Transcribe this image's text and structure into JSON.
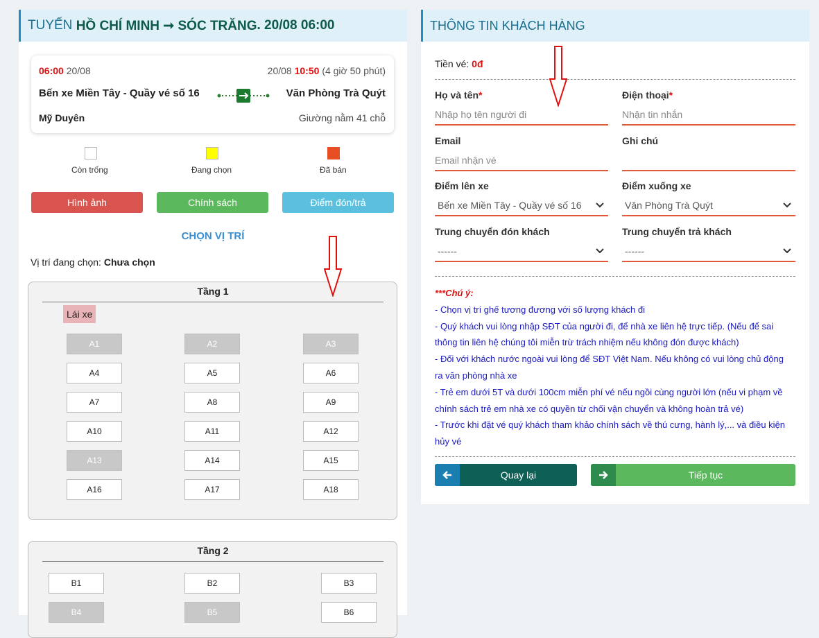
{
  "left": {
    "title_prefix": "TUYẾN",
    "title_route": "HỒ CHÍ MINH ➞ SÓC TRĂNG",
    "title_time": ". 20/08 06:00",
    "trip": {
      "depart_time": "06:00",
      "depart_date": "20/08",
      "arrive_date": "20/08",
      "arrive_time": "10:50",
      "duration": "(4 giờ 50 phút)",
      "from": "Bến xe Miền Tây - Quầy vé số 16",
      "to": "Văn Phòng Trà Quýt",
      "operator": "Mỹ Duyên",
      "vehicle": "Giường nằm 41 chỗ"
    },
    "legend": {
      "empty": "Còn trống",
      "selecting": "Đang chọn",
      "sold": "Đã bán"
    },
    "colors": {
      "empty": "#ffffff",
      "selecting": "#ffff00",
      "sold": "#e84e23"
    },
    "buttons": {
      "images": "Hình ảnh",
      "policy": "Chính sách",
      "pickup": "Điểm đón/trả"
    },
    "choose_seat": "CHỌN VỊ TRÍ",
    "selected_label": "Vị trí đang chọn:",
    "selected_value": "Chưa chọn",
    "floor1": {
      "title": "Tầng 1",
      "driver": "Lái xe",
      "seats": [
        {
          "label": "A1",
          "sold": true
        },
        {
          "label": "A2",
          "sold": true
        },
        {
          "label": "A3",
          "sold": true
        },
        {
          "label": "A4",
          "sold": false
        },
        {
          "label": "A5",
          "sold": false
        },
        {
          "label": "A6",
          "sold": false
        },
        {
          "label": "A7",
          "sold": false
        },
        {
          "label": "A8",
          "sold": false
        },
        {
          "label": "A9",
          "sold": false
        },
        {
          "label": "A10",
          "sold": false
        },
        {
          "label": "A11",
          "sold": false
        },
        {
          "label": "A12",
          "sold": false
        },
        {
          "label": "A13",
          "sold": true
        },
        {
          "label": "A14",
          "sold": false
        },
        {
          "label": "A15",
          "sold": false
        },
        {
          "label": "A16",
          "sold": false
        },
        {
          "label": "A17",
          "sold": false
        },
        {
          "label": "A18",
          "sold": false
        }
      ]
    },
    "floor2": {
      "title": "Tầng 2",
      "seats": [
        {
          "label": "B1",
          "sold": false
        },
        {
          "label": "B2",
          "sold": false
        },
        {
          "label": "B3",
          "sold": false
        },
        {
          "label": "B4",
          "sold": true
        },
        {
          "label": "B5",
          "sold": true
        },
        {
          "label": "B6",
          "sold": false
        }
      ]
    }
  },
  "right": {
    "title": "THÔNG TIN KHÁCH HÀNG",
    "fare_label": "Tiền vé:",
    "fare_value": "0đ",
    "name_label": "Họ và tên",
    "name_placeholder": "Nhập họ tên người đi",
    "phone_label": "Điện thoại",
    "phone_placeholder": "Nhận tin nhắn",
    "required_mark": "*",
    "email_label": "Email",
    "email_placeholder": "Email nhận vé",
    "note_label": "Ghi chú",
    "pickup_label": "Điểm lên xe",
    "pickup_value": "Bến xe Miền Tây - Quầy vé số 16",
    "dropoff_label": "Điểm xuống xe",
    "dropoff_value": "Văn Phòng Trà Quýt",
    "transfer_pickup_label": "Trung chuyển đón khách",
    "transfer_pickup_value": "------",
    "transfer_drop_label": "Trung chuyển trả khách",
    "transfer_drop_value": "------",
    "notice_title": "***Chú ý:",
    "notes": [
      "- Chọn vị trí ghế tương đương với số lượng khách đi",
      "- Quý khách vui lòng nhập SĐT của người đi, để nhà xe liên hệ trực tiếp. (Nếu để sai",
      "thông tin liên hệ chúng tôi miễn trừ trách nhiệm nếu không đón được khách)",
      "- Đối với khách nước ngoài vui lòng để SĐT Việt Nam. Nếu không có vui lòng chủ động",
      "ra văn phòng nhà xe",
      "- Trẻ em dưới 5T và dưới 100cm miễn phí vé nếu ngồi cùng người lớn (nếu vi phạm về",
      "chính sách trẻ em nhà xe có quyền từ chối vận chuyển và không hoàn trả vé)",
      "- Trước khi đặt vé quý khách tham khảo chính sách về thú cưng, hành lý,... và điều kiện",
      "hủy vé"
    ],
    "back_label": "Quay lại",
    "next_label": "Tiếp tục"
  }
}
